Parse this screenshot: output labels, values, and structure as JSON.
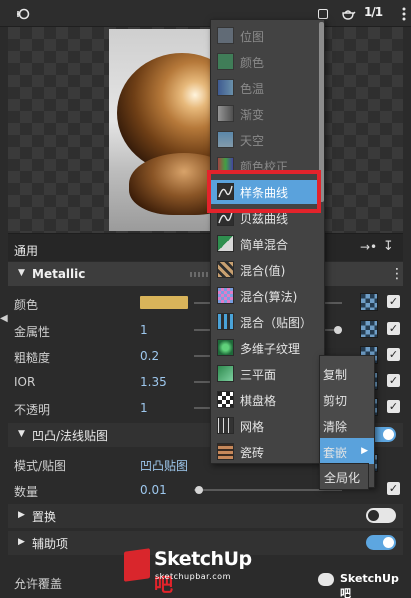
{
  "toolbar": {
    "frame_counter": "1/1"
  },
  "panel": {
    "general_label": "通用",
    "material_name": "Metallic",
    "rows": [
      {
        "label": "颜色",
        "value": "",
        "swatch_color": "#d9b45a"
      },
      {
        "label": "金属性",
        "value": "1",
        "slider": 1.0
      },
      {
        "label": "粗糙度",
        "value": "0.2",
        "slider": 0.2
      },
      {
        "label": "IOR",
        "value": "1.35",
        "slider": 0.14
      },
      {
        "label": "不透明",
        "value": "1",
        "slider": 1.0
      }
    ],
    "bump_section": "凹凸/法线贴图",
    "bump_rows": [
      {
        "label": "模式/贴图",
        "value": "凹凸贴图"
      },
      {
        "label": "数量",
        "value": "0.01",
        "slider": 0.01
      }
    ],
    "displacement_section": "置换",
    "aux_section": "辅助项",
    "footer": "允许覆盖"
  },
  "dropdown": {
    "items": [
      {
        "label": "位图",
        "state": "disabled",
        "icon": "bitmap-icon"
      },
      {
        "label": "颜色",
        "state": "disabled",
        "icon": "color-icon"
      },
      {
        "label": "色温",
        "state": "disabled",
        "icon": "color-temperature-icon"
      },
      {
        "label": "渐变",
        "state": "disabled",
        "icon": "gradient-icon"
      },
      {
        "label": "天空",
        "state": "disabled",
        "icon": "sky-icon"
      },
      {
        "label": "颜色校正",
        "state": "disabled",
        "icon": "color-correction-icon"
      },
      {
        "label": "样条曲线",
        "state": "hover",
        "icon": "spline-curve-icon"
      },
      {
        "label": "贝兹曲线",
        "state": "normal",
        "icon": "bezier-curve-icon"
      },
      {
        "label": "简单混合",
        "state": "normal",
        "icon": "simple-blend-icon"
      },
      {
        "label": "混合(值)",
        "state": "normal",
        "icon": "blend-value-icon"
      },
      {
        "label": "混合(算法)",
        "state": "normal",
        "icon": "blend-algorithm-icon"
      },
      {
        "label": "混合（贴图）",
        "state": "normal",
        "icon": "blend-map-icon"
      },
      {
        "label": "多维子纹理",
        "state": "normal",
        "icon": "multi-sub-texture-icon"
      },
      {
        "label": "三平面",
        "state": "normal",
        "icon": "triplanar-icon"
      },
      {
        "label": "棋盘格",
        "state": "normal",
        "icon": "checker-icon"
      },
      {
        "label": "网格",
        "state": "normal",
        "icon": "grid-icon"
      },
      {
        "label": "瓷砖",
        "state": "normal",
        "icon": "tiles-icon"
      }
    ]
  },
  "context_menu": {
    "items": [
      "复制",
      "剪切",
      "清除",
      "套嵌"
    ],
    "submenu": "全局化"
  },
  "watermark": {
    "brand": "SketchUp",
    "brand_suffix": "吧",
    "url": "sketchupbar.com",
    "wechat": "SketchUp吧"
  },
  "colors": {
    "accent": "#5aa2dc",
    "highlight": "#e3232b",
    "value_text": "#9ec8ee"
  }
}
